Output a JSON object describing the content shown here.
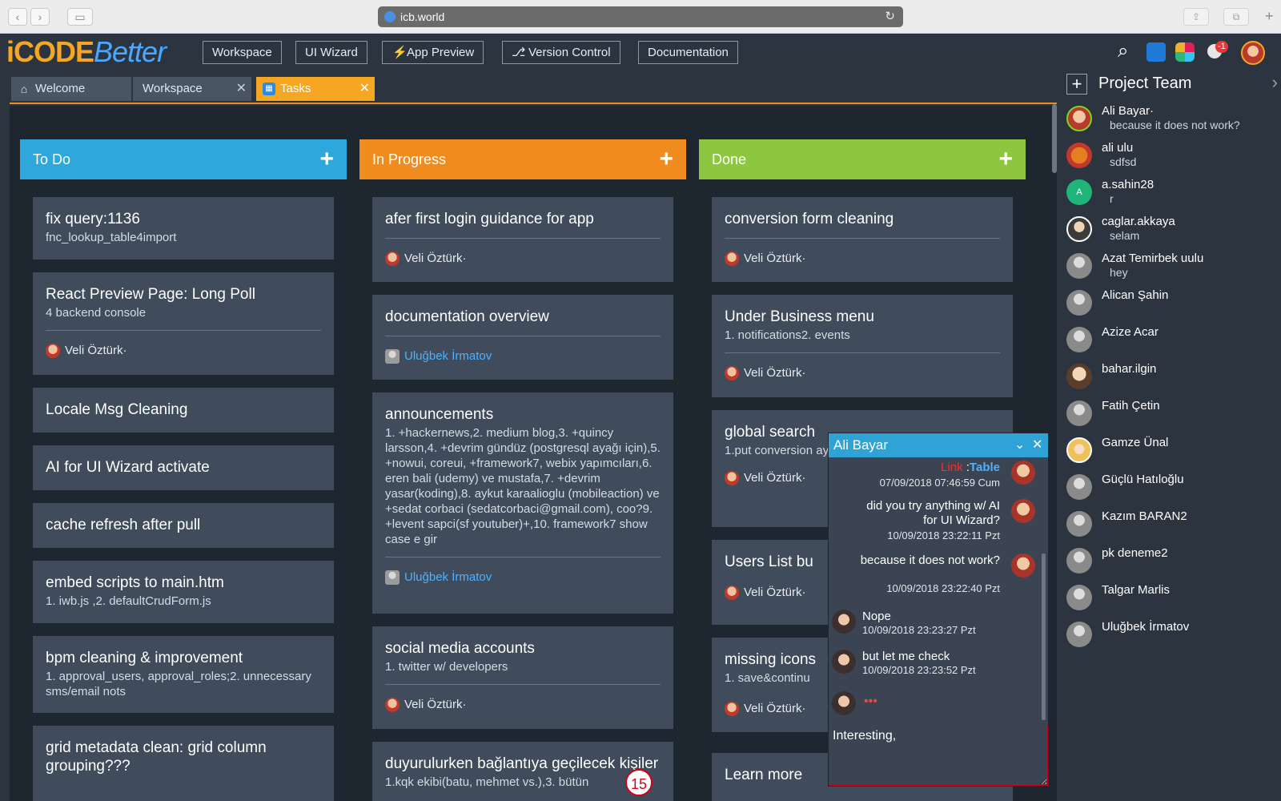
{
  "browser": {
    "url": "icb.world"
  },
  "app": {
    "logo_part1": "iCODE",
    "logo_part2": "Better",
    "nav": [
      "Workspace",
      "UI Wizard",
      "App Preview",
      "Version Control",
      "Documentation"
    ],
    "notification_count": "-1"
  },
  "tabs": [
    {
      "label": "Welcome",
      "icon": "home-icon"
    },
    {
      "label": "Workspace",
      "icon": ""
    },
    {
      "label": "Tasks",
      "icon": "trello-icon"
    }
  ],
  "columns": [
    {
      "title": "To Do",
      "color": "#2ea7dd",
      "cards": [
        {
          "title": "fix query:1136",
          "desc": "fnc_lookup_table4import"
        },
        {
          "title": "React Preview Page: Long Poll",
          "desc": "4 backend console",
          "assignee": "Veli Öztürk·"
        },
        {
          "title": "Locale Msg Cleaning"
        },
        {
          "title": "AI for UI Wizard activate"
        },
        {
          "title": "cache refresh after pull"
        },
        {
          "title": "embed scripts to main.htm",
          "desc": "1. iwb.js ,2. defaultCrudForm.js"
        },
        {
          "title": "bpm cleaning & improvement",
          "desc": "1. approval_users, approval_roles;2. unnecessary sms/email nots"
        },
        {
          "title": "grid metadata clean: grid column grouping???"
        }
      ]
    },
    {
      "title": "In Progress",
      "color": "#f08c1d",
      "cards": [
        {
          "title": "afer first login guidance for app",
          "assignee": "Veli Öztürk·"
        },
        {
          "title": "documentation overview",
          "assignee": "Uluğbek İrmatov"
        },
        {
          "title": "announcements",
          "desc": "1. +hackernews,2. medium blog,3. +quincy larsson,4. +devrim gündüz (postgresql ayağı için),5. +nowui, coreui, +framework7, webix yapımcıları,6. eren bali (udemy) ve mustafa,7. +devrim yasar(koding),8. aykut karaalioglu (mobileaction) ve +sedat corbaci (sedatcorbaci@gmail.com), coo?9. +levent sapci(sf youtuber)+,10. framework7 show case e gir",
          "assignee": "Uluğbek İrmatov"
        },
        {
          "title": "social media accounts",
          "desc": "1. twitter w/ developers",
          "assignee": "Veli Öztürk·"
        },
        {
          "title": "duyurulurken bağlantıya geçilecek kişiler",
          "desc": "1.kqk ekibi(batu, mehmet vs.),3. bütün"
        }
      ],
      "badge": "15"
    },
    {
      "title": "Done",
      "color": "#8dc63f",
      "cards": [
        {
          "title": "conversion form cleaning",
          "assignee": "Veli Öztürk·"
        },
        {
          "title": "Under Business menu",
          "desc": "1. notifications2. events",
          "assignee": "Veli Öztürk·"
        },
        {
          "title": "global search",
          "desc": "1.put conversion ayır, js'ten",
          "assignee": "Veli Öztürk·"
        },
        {
          "title": "Users List bu",
          "assignee": "Veli Öztürk·"
        },
        {
          "title": "missing icons",
          "desc": "1. save&continu",
          "assignee": "Veli Öztürk·"
        },
        {
          "title": "Learn more"
        }
      ]
    }
  ],
  "team": {
    "title": "Project Team",
    "members": [
      {
        "name": "Ali Bayar·",
        "status": "because it does not work?",
        "avatar": "photo"
      },
      {
        "name": "ali ulu",
        "status": "sdfsd",
        "avatar": "orange"
      },
      {
        "name": "a.sahin28",
        "status": "r",
        "avatar": "teal",
        "initial": "A"
      },
      {
        "name": "caglar.akkaya",
        "status": "selam",
        "avatar": "beard"
      },
      {
        "name": "Azat Temirbek uulu",
        "status": "hey",
        "avatar": "person"
      },
      {
        "name": "Alican Şahin",
        "status": "",
        "avatar": "person"
      },
      {
        "name": "Azize Acar",
        "status": "",
        "avatar": "person"
      },
      {
        "name": "bahar.ilgin",
        "status": "",
        "avatar": "woman"
      },
      {
        "name": "Fatih Çetin",
        "status": "",
        "avatar": "person"
      },
      {
        "name": "Gamze Ünal",
        "status": "",
        "avatar": "blonde"
      },
      {
        "name": "Güçlü Hatıloğlu",
        "status": "",
        "avatar": "person"
      },
      {
        "name": "Kazım BARAN2",
        "status": "",
        "avatar": "person"
      },
      {
        "name": "pk deneme2",
        "status": "",
        "avatar": "person"
      },
      {
        "name": "Talgar Marlis",
        "status": "",
        "avatar": "person"
      },
      {
        "name": "Uluğbek İrmatov",
        "status": "",
        "avatar": "person"
      }
    ]
  },
  "chat": {
    "title": "Ali Bayar",
    "messages": [
      {
        "side": "r",
        "link_label": "Link",
        "link_sep": " :",
        "link_target": "Table",
        "time": "07/09/2018 07:46:59 Cum"
      },
      {
        "side": "r",
        "text": "did you try anything w/ AI for UI Wizard?",
        "time": "10/09/2018 23:22:11 Pzt"
      },
      {
        "side": "r",
        "text": "because it does not work?",
        "time": "10/09/2018 23:22:40 Pzt"
      },
      {
        "side": "l",
        "text": "Nope",
        "time": "10/09/2018 23:23:27 Pzt"
      },
      {
        "side": "l",
        "text": "but let me check",
        "time": "10/09/2018 23:23:52 Pzt"
      }
    ],
    "typing": "•••",
    "input_value": "Interesting,"
  }
}
